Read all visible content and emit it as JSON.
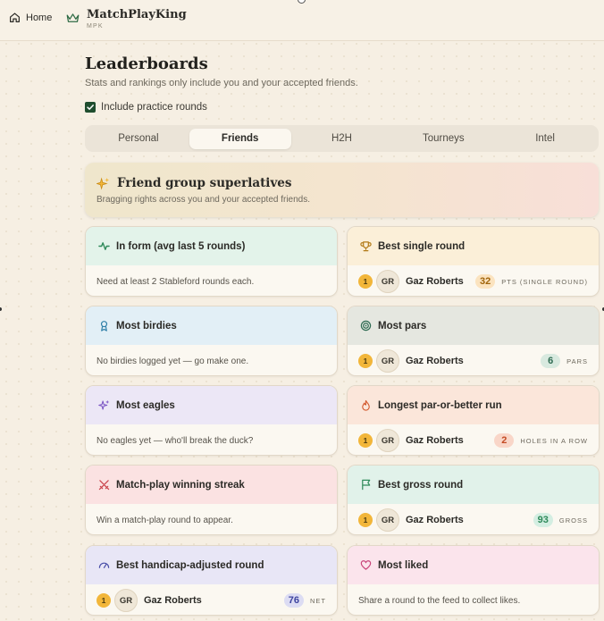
{
  "nav": {
    "home_label": "Home"
  },
  "brand": {
    "name": "MatchPlayKing",
    "short": "MPK"
  },
  "page": {
    "title": "Leaderboards",
    "subtitle": "Stats and rankings only include you and your accepted friends.",
    "practice_label": "Include practice rounds",
    "practice_checked": true
  },
  "tabs": [
    {
      "label": "Personal",
      "active": false
    },
    {
      "label": "Friends",
      "active": true
    },
    {
      "label": "H2H",
      "active": false
    },
    {
      "label": "Tourneys",
      "active": false
    },
    {
      "label": "Intel",
      "active": false
    }
  ],
  "superlatives": {
    "title": "Friend group superlatives",
    "subtitle": "Bragging rights across you and your accepted friends."
  },
  "cards": [
    {
      "id": "in-form",
      "title": "In form (avg last 5 rounds)",
      "icon": "activity-icon",
      "accent": "#e3f3ea",
      "icon_color": "#2f8a5a",
      "empty_text": "Need at least 2 Stableford rounds each."
    },
    {
      "id": "best-single-round",
      "title": "Best single round",
      "icon": "trophy-icon",
      "accent": "#fbefd8",
      "icon_color": "#b27a17",
      "rank": "1",
      "initials": "GR",
      "player": "Gaz Roberts",
      "value": "32",
      "unit": "PTS (SINGLE ROUND)",
      "pill_bg": "#fbe3bf",
      "pill_fg": "#a0640a"
    },
    {
      "id": "most-birdies",
      "title": "Most birdies",
      "icon": "ribbon-icon",
      "accent": "#e2eff6",
      "icon_color": "#2f7fa8",
      "empty_text": "No birdies logged yet — go make one."
    },
    {
      "id": "most-pars",
      "title": "Most pars",
      "icon": "target-icon",
      "accent": "#e5e7e0",
      "icon_color": "#2e6b52",
      "rank": "1",
      "initials": "GR",
      "player": "Gaz Roberts",
      "value": "6",
      "unit": "PARS",
      "pill_bg": "#d8e9df",
      "pill_fg": "#2e6b52"
    },
    {
      "id": "most-eagles",
      "title": "Most eagles",
      "icon": "sparkles-icon",
      "accent": "#ece7f6",
      "icon_color": "#7b55c4",
      "empty_text": "No eagles yet — who'll break the duck?"
    },
    {
      "id": "longest-run",
      "title": "Longest par-or-better run",
      "icon": "flame-icon",
      "accent": "#fbe6da",
      "icon_color": "#d2572c",
      "rank": "1",
      "initials": "GR",
      "player": "Gaz Roberts",
      "value": "2",
      "unit": "HOLES IN A ROW",
      "pill_bg": "#f9d6c8",
      "pill_fg": "#c44b24"
    },
    {
      "id": "winning-streak",
      "title": "Match-play winning streak",
      "icon": "swords-icon",
      "accent": "#fbe2e2",
      "icon_color": "#c9424a",
      "empty_text": "Win a match-play round to appear."
    },
    {
      "id": "best-gross",
      "title": "Best gross round",
      "icon": "flag-icon",
      "accent": "#e1f2ea",
      "icon_color": "#2f8a5a",
      "rank": "1",
      "initials": "GR",
      "player": "Gaz Roberts",
      "value": "93",
      "unit": "GROSS",
      "pill_bg": "#d4eee2",
      "pill_fg": "#2f8a5a"
    },
    {
      "id": "best-handicap",
      "title": "Best handicap-adjusted round",
      "icon": "gauge-icon",
      "accent": "#e8e6f6",
      "icon_color": "#4a4fa8",
      "rank": "1",
      "initials": "GR",
      "player": "Gaz Roberts",
      "value": "76",
      "unit": "NET",
      "pill_bg": "#dcdcf3",
      "pill_fg": "#3d43a0"
    },
    {
      "id": "most-liked",
      "title": "Most liked",
      "icon": "heart-icon",
      "accent": "#fbe4ec",
      "icon_color": "#c9457a",
      "empty_text": "Share a round to the feed to collect likes."
    }
  ]
}
